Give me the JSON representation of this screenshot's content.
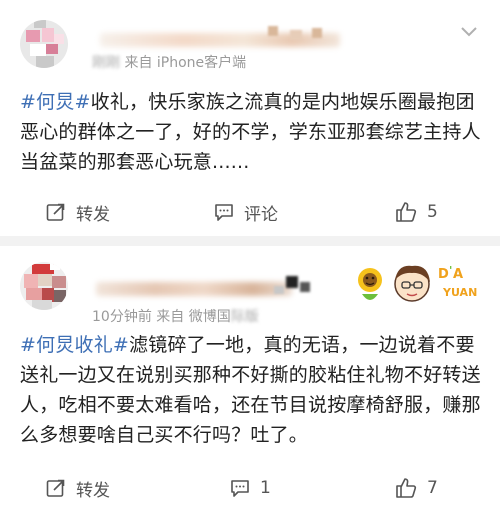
{
  "posts": [
    {
      "meta_prefix": "",
      "meta_blurred": "刚刚",
      "meta_source_prefix": "来自 ",
      "meta_source": "iPhone客户端",
      "content_tag": "#何炅#",
      "content_text": "收礼，快乐家族之流真的是内地娱乐圈最抱团恶心的群体之一了，好的不学，学东亚那套综艺主持人当盆菜的那套恶心玩意......",
      "share_label": "转发",
      "comment_label": "评论",
      "like_count": "5"
    },
    {
      "meta_time": "10分钟前",
      "meta_source_prefix": "来自 微博国",
      "meta_blurred": "际版",
      "content_tag": "#何炅收礼#",
      "content_text": "滤镜碎了一地，真的无语，一边说着不要送礼一边又在说别买那种不好撕的胶粘住礼物不好转送人，吃相不要太难看哈，还在节目说按摩椅舒服，赚那么多想要啥自己买不行吗？吐了。",
      "share_label": "转发",
      "comment_count": "1",
      "like_count": "7",
      "decor_text": "YUAN"
    }
  ],
  "colors": {
    "tag": "#3e6fb5",
    "text": "#222222",
    "meta": "#9a9a9a",
    "separator": "#f2f2f2"
  }
}
